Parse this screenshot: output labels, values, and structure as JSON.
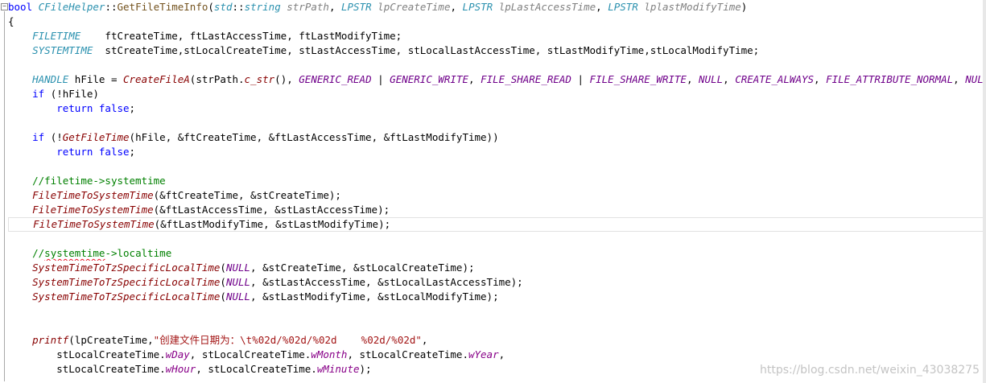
{
  "colors": {
    "keyword": "#0000ff",
    "type": "#2b91af",
    "func_user": "#74531f",
    "func_sys": "#880000",
    "macro": "#6f008a",
    "comment": "#008000",
    "string": "#a31515",
    "param": "#808080",
    "member": "#880088",
    "plain": "#000000"
  },
  "current_line_index": 15,
  "squiggle_tokens": [
    {
      "line": 17,
      "token": 2
    },
    {
      "line": 22,
      "token": 3
    }
  ],
  "lines": [
    [
      [
        "keyword",
        "bool"
      ],
      [
        "plain",
        " "
      ],
      [
        "type",
        "CFileHelper"
      ],
      [
        "plain",
        "::"
      ],
      [
        "func_user",
        "GetFileTimeInfo"
      ],
      [
        "plain",
        "("
      ],
      [
        "type",
        "std"
      ],
      [
        "plain",
        "::"
      ],
      [
        "type",
        "string"
      ],
      [
        "plain",
        " "
      ],
      [
        "param",
        "strPath"
      ],
      [
        "plain",
        ", "
      ],
      [
        "type",
        "LPSTR"
      ],
      [
        "plain",
        " "
      ],
      [
        "param",
        "lpCreateTime"
      ],
      [
        "plain",
        ", "
      ],
      [
        "type",
        "LPSTR"
      ],
      [
        "plain",
        " "
      ],
      [
        "param",
        "lpLastAccessTime"
      ],
      [
        "plain",
        ", "
      ],
      [
        "type",
        "LPSTR"
      ],
      [
        "plain",
        " "
      ],
      [
        "param",
        "lplastModifyTime"
      ],
      [
        "plain",
        ")"
      ]
    ],
    [
      [
        "plain",
        "{"
      ]
    ],
    [
      [
        "plain",
        "    "
      ],
      [
        "type",
        "FILETIME"
      ],
      [
        "plain",
        "    ftCreateTime, ftLastAccessTime, ftLastModifyTime;"
      ]
    ],
    [
      [
        "plain",
        "    "
      ],
      [
        "type",
        "SYSTEMTIME"
      ],
      [
        "plain",
        "  stCreateTime,stLocalCreateTime, stLastAccessTime, stLocalLastAccessTime, stLastModifyTime,stLocalModifyTime;"
      ]
    ],
    [],
    [
      [
        "plain",
        "    "
      ],
      [
        "type",
        "HANDLE"
      ],
      [
        "plain",
        " hFile = "
      ],
      [
        "func_sys",
        "CreateFileA"
      ],
      [
        "plain",
        "(strPath."
      ],
      [
        "func_sys",
        "c_str"
      ],
      [
        "plain",
        "(), "
      ],
      [
        "macro",
        "GENERIC_READ"
      ],
      [
        "plain",
        " | "
      ],
      [
        "macro",
        "GENERIC_WRITE"
      ],
      [
        "plain",
        ", "
      ],
      [
        "macro",
        "FILE_SHARE_READ"
      ],
      [
        "plain",
        " | "
      ],
      [
        "macro",
        "FILE_SHARE_WRITE"
      ],
      [
        "plain",
        ", "
      ],
      [
        "macro",
        "NULL"
      ],
      [
        "plain",
        ", "
      ],
      [
        "macro",
        "CREATE_ALWAYS"
      ],
      [
        "plain",
        ", "
      ],
      [
        "macro",
        "FILE_ATTRIBUTE_NORMAL"
      ],
      [
        "plain",
        ", "
      ],
      [
        "macro",
        "NULL"
      ],
      [
        "plain",
        ");"
      ]
    ],
    [
      [
        "plain",
        "    "
      ],
      [
        "keyword",
        "if"
      ],
      [
        "plain",
        " (!hFile)"
      ]
    ],
    [
      [
        "plain",
        "        "
      ],
      [
        "keyword",
        "return"
      ],
      [
        "plain",
        " "
      ],
      [
        "keyword",
        "false"
      ],
      [
        "plain",
        ";"
      ]
    ],
    [],
    [
      [
        "plain",
        "    "
      ],
      [
        "keyword",
        "if"
      ],
      [
        "plain",
        " (!"
      ],
      [
        "func_sys",
        "GetFileTime"
      ],
      [
        "plain",
        "(hFile, &ftCreateTime, &ftLastAccessTime, &ftLastModifyTime))"
      ]
    ],
    [
      [
        "plain",
        "        "
      ],
      [
        "keyword",
        "return"
      ],
      [
        "plain",
        " "
      ],
      [
        "keyword",
        "false"
      ],
      [
        "plain",
        ";"
      ]
    ],
    [],
    [
      [
        "plain",
        "    "
      ],
      [
        "comment",
        "//filetime->systemtime"
      ]
    ],
    [
      [
        "plain",
        "    "
      ],
      [
        "func_sys",
        "FileTimeToSystemTime"
      ],
      [
        "plain",
        "(&ftCreateTime, &stCreateTime);"
      ]
    ],
    [
      [
        "plain",
        "    "
      ],
      [
        "func_sys",
        "FileTimeToSystemTime"
      ],
      [
        "plain",
        "(&ftLastAccessTime, &stLastAccessTime);"
      ]
    ],
    [
      [
        "plain",
        "    "
      ],
      [
        "func_sys",
        "FileTimeToSystemTime"
      ],
      [
        "plain",
        "(&ftLastModifyTime, &stLastModifyTime);"
      ]
    ],
    [],
    [
      [
        "plain",
        "    "
      ],
      [
        "comment",
        "//"
      ],
      [
        "comment",
        "systemtime"
      ],
      [
        "comment",
        "->localtime"
      ]
    ],
    [
      [
        "plain",
        "    "
      ],
      [
        "func_sys",
        "SystemTimeToTzSpecificLocalTime"
      ],
      [
        "plain",
        "("
      ],
      [
        "macro",
        "NULL"
      ],
      [
        "plain",
        ", &stCreateTime, &stLocalCreateTime);"
      ]
    ],
    [
      [
        "plain",
        "    "
      ],
      [
        "func_sys",
        "SystemTimeToTzSpecificLocalTime"
      ],
      [
        "plain",
        "("
      ],
      [
        "macro",
        "NULL"
      ],
      [
        "plain",
        ", &stLastAccessTime, &stLocalLastAccessTime);"
      ]
    ],
    [
      [
        "plain",
        "    "
      ],
      [
        "func_sys",
        "SystemTimeToTzSpecificLocalTime"
      ],
      [
        "plain",
        "("
      ],
      [
        "macro",
        "NULL"
      ],
      [
        "plain",
        ", &stLastModifyTime, &stLocalModifyTime);"
      ]
    ],
    [],
    [],
    [
      [
        "plain",
        "    "
      ],
      [
        "func_sys",
        "printf"
      ],
      [
        "plain",
        "(lpCreateTime,"
      ],
      [
        "string",
        "\"创建文件日期为：\\t%02d/%02d/%02d    %02d/%02d\""
      ],
      [
        "plain",
        ","
      ]
    ],
    [
      [
        "plain",
        "        stLocalCreateTime."
      ],
      [
        "member",
        "wDay"
      ],
      [
        "plain",
        ", stLocalCreateTime."
      ],
      [
        "member",
        "wMonth"
      ],
      [
        "plain",
        ", stLocalCreateTime."
      ],
      [
        "member",
        "wYear"
      ],
      [
        "plain",
        ","
      ]
    ],
    [
      [
        "plain",
        "        stLocalCreateTime."
      ],
      [
        "member",
        "wHour"
      ],
      [
        "plain",
        ", stLocalCreateTime."
      ],
      [
        "member",
        "wMinute"
      ],
      [
        "plain",
        ");"
      ]
    ]
  ],
  "fold_glyph": "⊟",
  "watermark": "https://blog.csdn.net/weixin_43038275"
}
